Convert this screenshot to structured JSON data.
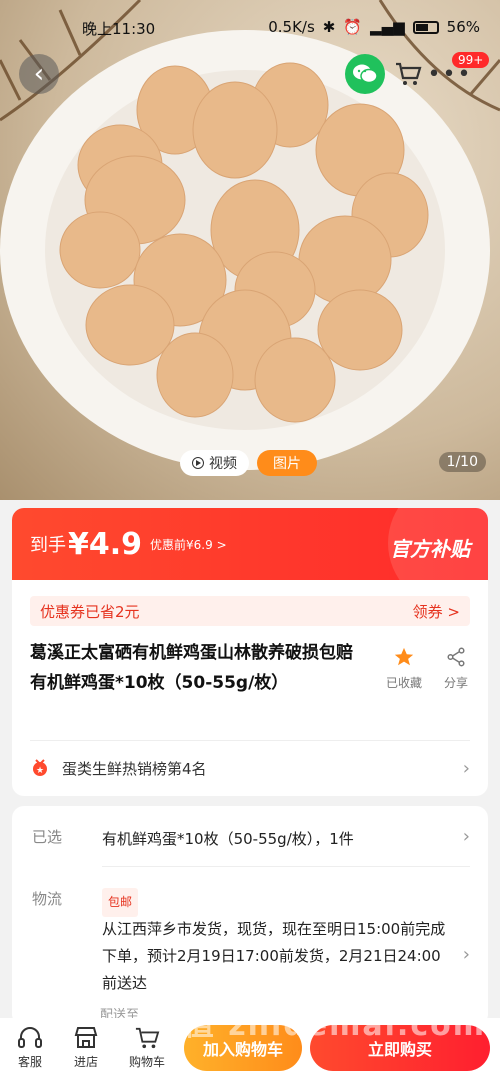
{
  "status_bar": {
    "time": "晚上11:30",
    "speed": "0.5K/s",
    "battery": "56%"
  },
  "top_bar": {
    "cart_badge": "99+"
  },
  "media": {
    "video_label": "视频",
    "photo_label": "图片",
    "counter": "1/10"
  },
  "price": {
    "prefix": "到手",
    "amount": "¥4.9",
    "original": "优惠前¥6.9 >",
    "official_label": "官方补贴"
  },
  "coupon": {
    "text": "优惠券已省2元",
    "action": "领券 >"
  },
  "product": {
    "title": "葛溪正太富硒有机鲜鸡蛋山林散养破损包赔 有机鲜鸡蛋*10枚（50-55g/枚）",
    "favorite_label": "已收藏",
    "share_label": "分享"
  },
  "rank": {
    "text": "蛋类生鲜热销榜第4名"
  },
  "selection": {
    "label": "已选",
    "value": "有机鲜鸡蛋*10枚（50-55g/枚），1件"
  },
  "logistics": {
    "label": "物流",
    "tag": "包邮",
    "text": "从江西萍乡市发货，现货，现在至明日15:00前完成下单，预计2月19日17:00前发货，2月21日24:00前送达",
    "deliver_to_label": "配送至"
  },
  "bottom_nav": {
    "service": "客服",
    "store": "进店",
    "cart": "购物车",
    "add_to_cart": "加入购物车",
    "buy_now": "立即购买"
  },
  "watermark": "值 zhidemai.com",
  "colors": {
    "accent_red": "#ff2a2a",
    "accent_orange": "#ff8c1a",
    "wechat_green": "#20c15c"
  }
}
